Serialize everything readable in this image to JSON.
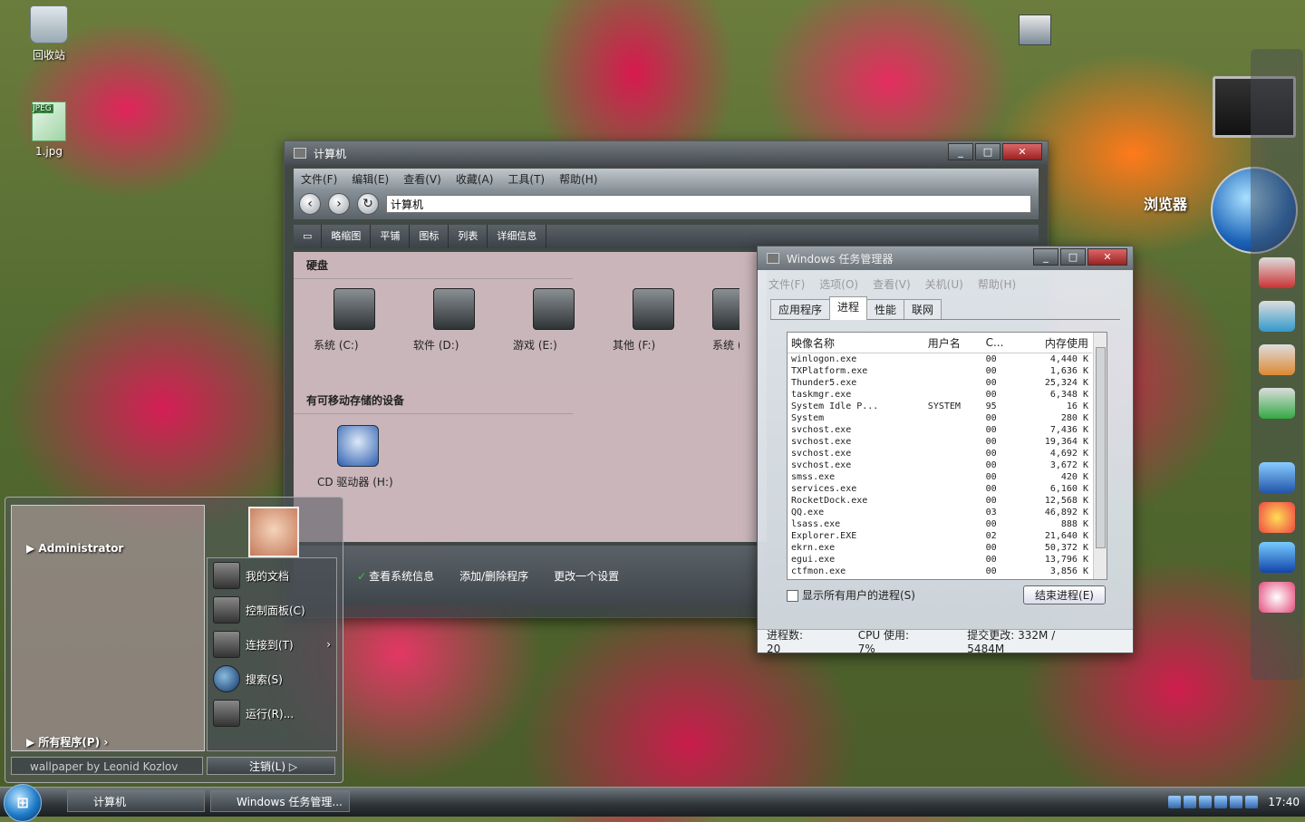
{
  "desktop": {
    "icons": [
      {
        "label": "回收站"
      },
      {
        "label": "1.jpg",
        "badge": "JPEG"
      }
    ],
    "browser_label": "浏览器"
  },
  "explorer": {
    "title": "计算机",
    "menu": [
      "文件(F)",
      "编辑(E)",
      "查看(V)",
      "收藏(A)",
      "工具(T)",
      "帮助(H)"
    ],
    "address": "计算机",
    "toolbar": [
      "略缩图",
      "平铺",
      "图标",
      "列表",
      "详细信息"
    ],
    "section_hdd": "硬盘",
    "drives": [
      {
        "label": "系统 (C:)"
      },
      {
        "label": "软件 (D:)"
      },
      {
        "label": "游戏 (E:)"
      },
      {
        "label": "其他 (F:)"
      },
      {
        "label": "系统 (G"
      }
    ],
    "section_removable": "有可移动存储的设备",
    "cd_label": "CD 驱动器 (H:)",
    "tasks": [
      "查看系统信息",
      "添加/删除程序",
      "更改一个设置"
    ]
  },
  "taskmgr": {
    "title": "Windows 任务管理器",
    "menu": [
      "文件(F)",
      "选项(O)",
      "查看(V)",
      "关机(U)",
      "帮助(H)"
    ],
    "tabs": [
      "应用程序",
      "进程",
      "性能",
      "联网"
    ],
    "active_tab": "进程",
    "columns": [
      "映像名称",
      "用户名",
      "C...",
      "内存使用"
    ],
    "processes": [
      {
        "name": "winlogon.exe",
        "user": "",
        "cpu": "00",
        "mem": "4,440 K"
      },
      {
        "name": "TXPlatform.exe",
        "user": "",
        "cpu": "00",
        "mem": "1,636 K"
      },
      {
        "name": "Thunder5.exe",
        "user": "",
        "cpu": "00",
        "mem": "25,324 K"
      },
      {
        "name": "taskmgr.exe",
        "user": "",
        "cpu": "00",
        "mem": "6,348 K"
      },
      {
        "name": "System Idle P...",
        "user": "SYSTEM",
        "cpu": "95",
        "mem": "16 K"
      },
      {
        "name": "System",
        "user": "",
        "cpu": "00",
        "mem": "280 K"
      },
      {
        "name": "svchost.exe",
        "user": "",
        "cpu": "00",
        "mem": "7,436 K"
      },
      {
        "name": "svchost.exe",
        "user": "",
        "cpu": "00",
        "mem": "19,364 K"
      },
      {
        "name": "svchost.exe",
        "user": "",
        "cpu": "00",
        "mem": "4,692 K"
      },
      {
        "name": "svchost.exe",
        "user": "",
        "cpu": "00",
        "mem": "3,672 K"
      },
      {
        "name": "smss.exe",
        "user": "",
        "cpu": "00",
        "mem": "420 K"
      },
      {
        "name": "services.exe",
        "user": "",
        "cpu": "00",
        "mem": "6,160 K"
      },
      {
        "name": "RocketDock.exe",
        "user": "",
        "cpu": "00",
        "mem": "12,568 K"
      },
      {
        "name": "QQ.exe",
        "user": "",
        "cpu": "03",
        "mem": "46,892 K"
      },
      {
        "name": "lsass.exe",
        "user": "",
        "cpu": "00",
        "mem": "888 K"
      },
      {
        "name": "Explorer.EXE",
        "user": "",
        "cpu": "02",
        "mem": "21,640 K"
      },
      {
        "name": "ekrn.exe",
        "user": "",
        "cpu": "00",
        "mem": "50,372 K"
      },
      {
        "name": "egui.exe",
        "user": "",
        "cpu": "00",
        "mem": "13,796 K"
      },
      {
        "name": "ctfmon.exe",
        "user": "",
        "cpu": "00",
        "mem": "3,856 K"
      }
    ],
    "show_all_users": "显示所有用户的进程(S)",
    "end_process": "结束进程(E)",
    "status": {
      "processes": "进程数: 20",
      "cpu": "CPU 使用: 7%",
      "commit": "提交更改: 332M / 5484M"
    }
  },
  "startmenu": {
    "user": "Administrator",
    "all_programs": "所有程序(P)",
    "items": [
      {
        "label": "我的文档",
        "icon": "documents-icon"
      },
      {
        "label": "控制面板(C)",
        "icon": "control-panel-icon"
      },
      {
        "label": "连接到(T)",
        "icon": "connect-icon"
      },
      {
        "label": "搜索(S)",
        "icon": "search-icon"
      },
      {
        "label": "运行(R)...",
        "icon": "run-icon"
      }
    ],
    "search_text": "wallpaper by Leonid Kozlov",
    "logoff": "注销(L)"
  },
  "taskbar": {
    "buttons": [
      "计算机",
      "Windows 任务管理..."
    ],
    "clock": "17:40"
  },
  "colors": {
    "accent": "#1e7bc8",
    "petal": "#e0245a",
    "orange": "#ff7a1a"
  }
}
